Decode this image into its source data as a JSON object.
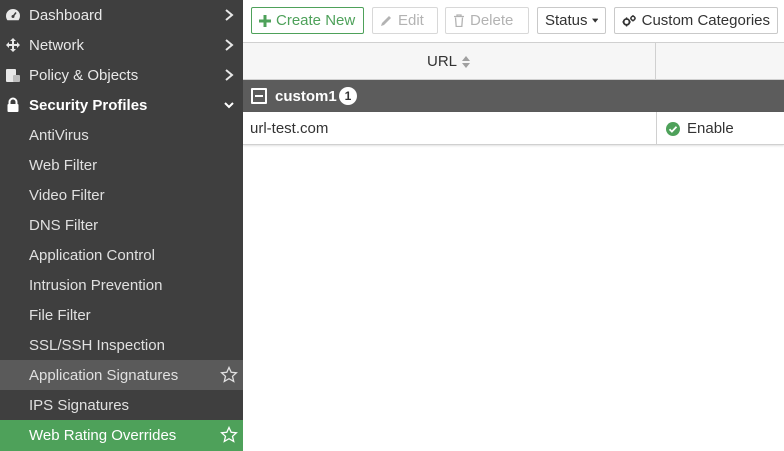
{
  "sidebar": {
    "top_items": [
      {
        "label": "Dashboard",
        "icon": "dashboard-icon"
      },
      {
        "label": "Network",
        "icon": "network-icon"
      },
      {
        "label": "Policy & Objects",
        "icon": "policy-icon"
      },
      {
        "label": "Security Profiles",
        "icon": "lock-icon"
      }
    ],
    "sub_items": [
      {
        "label": "AntiVirus"
      },
      {
        "label": "Web Filter"
      },
      {
        "label": "Video Filter"
      },
      {
        "label": "DNS Filter"
      },
      {
        "label": "Application Control"
      },
      {
        "label": "Intrusion Prevention"
      },
      {
        "label": "File Filter"
      },
      {
        "label": "SSL/SSH Inspection"
      },
      {
        "label": "Application Signatures"
      },
      {
        "label": "IPS Signatures"
      },
      {
        "label": "Web Rating Overrides"
      }
    ],
    "colors": {
      "background": "#3f3f3f",
      "active": "#4ea15a",
      "hover": "#5a5a5a"
    }
  },
  "toolbar": {
    "create_new_label": "Create New",
    "edit_label": "Edit",
    "delete_label": "Delete",
    "status_label": "Status",
    "custom_categories_label": "Custom Categories"
  },
  "table": {
    "columns": {
      "url": "URL"
    },
    "groups": [
      {
        "name": "custom1",
        "count": "1",
        "rows": [
          {
            "url": "url-test.com",
            "status": "Enable"
          }
        ]
      }
    ],
    "colors": {
      "group_row": "#5c5c5c",
      "status_ok": "#4ea15a"
    }
  }
}
